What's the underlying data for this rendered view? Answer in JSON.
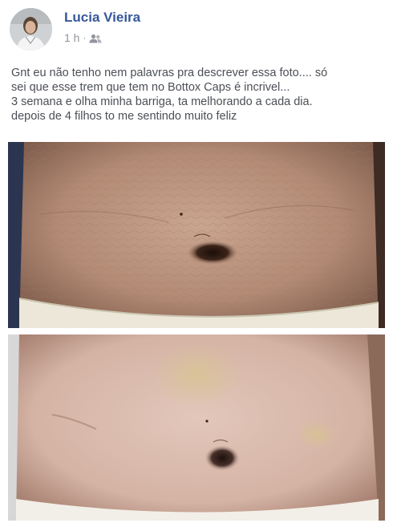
{
  "post": {
    "author_name": "Lucia Vieira",
    "timestamp": "1 h",
    "separator": "·",
    "audience_icon": "friends-icon",
    "text_lines": [
      "Gnt eu não tenho nem palavras pra descrever essa foto.... só",
      "sei que esse trem que tem no Bottox Caps é incrivel...",
      "3 semana e olha minha barriga, ta melhorando a cada dia.",
      "depois de 4 filhos to me sentindo muito feliz"
    ],
    "photos": [
      {
        "name": "before-photo"
      },
      {
        "name": "after-photo"
      }
    ]
  },
  "colors": {
    "author_link": "#365899",
    "meta_text": "#90949c",
    "body_text": "#4b4f56"
  }
}
